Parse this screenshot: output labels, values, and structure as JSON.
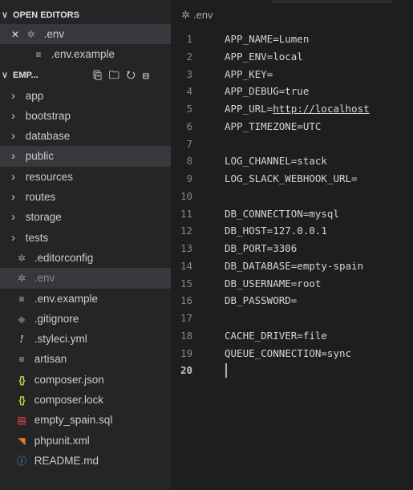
{
  "sidebar": {
    "open_editors": {
      "header": "OPEN EDITORS",
      "items": [
        {
          "label": ".env",
          "icon": "gear-icon"
        },
        {
          "label": ".env.example",
          "icon": "lines-icon"
        }
      ]
    },
    "explorer": {
      "header": "EMP...",
      "toolbar_icons": [
        "new-file-icon",
        "new-folder-icon",
        "refresh-icon",
        "collapse-all-icon"
      ],
      "folders": [
        {
          "label": "app"
        },
        {
          "label": "bootstrap"
        },
        {
          "label": "database"
        },
        {
          "label": "public"
        },
        {
          "label": "resources"
        },
        {
          "label": "routes"
        },
        {
          "label": "storage"
        },
        {
          "label": "tests"
        }
      ],
      "files": [
        {
          "label": ".editorconfig",
          "icon": "gear-icon"
        },
        {
          "label": ".env",
          "icon": "gear-icon"
        },
        {
          "label": ".env.example",
          "icon": "lines-icon"
        },
        {
          "label": ".gitignore",
          "icon": "diamond-icon"
        },
        {
          "label": ".styleci.yml",
          "icon": "exclamation-icon"
        },
        {
          "label": "artisan",
          "icon": "lines-icon"
        },
        {
          "label": "composer.json",
          "icon": "braces-icon"
        },
        {
          "label": "composer.lock",
          "icon": "braces-icon"
        },
        {
          "label": "empty_spain.sql",
          "icon": "database-icon"
        },
        {
          "label": "phpunit.xml",
          "icon": "rss-icon"
        },
        {
          "label": "README.md",
          "icon": "info-icon"
        }
      ]
    }
  },
  "editor": {
    "breadcrumb": ".env",
    "lines": [
      {
        "num": "1",
        "text": "APP_NAME=Lumen"
      },
      {
        "num": "2",
        "text": "APP_ENV=local"
      },
      {
        "num": "3",
        "text": "APP_KEY="
      },
      {
        "num": "4",
        "text": "APP_DEBUG=true"
      },
      {
        "num": "5",
        "text": "APP_URL=",
        "link": "http://localhost"
      },
      {
        "num": "6",
        "text": "APP_TIMEZONE=UTC"
      },
      {
        "num": "7",
        "text": ""
      },
      {
        "num": "8",
        "text": "LOG_CHANNEL=stack"
      },
      {
        "num": "9",
        "text": "LOG_SLACK_WEBHOOK_URL="
      },
      {
        "num": "10",
        "text": ""
      },
      {
        "num": "11",
        "text": "DB_CONNECTION=mysql"
      },
      {
        "num": "12",
        "text": "DB_HOST=127.0.0.1"
      },
      {
        "num": "13",
        "text": "DB_PORT=3306"
      },
      {
        "num": "14",
        "text": "DB_DATABASE=empty-spain"
      },
      {
        "num": "15",
        "text": "DB_USERNAME=root"
      },
      {
        "num": "16",
        "text": "DB_PASSWORD="
      },
      {
        "num": "17",
        "text": ""
      },
      {
        "num": "18",
        "text": "CACHE_DRIVER=file"
      },
      {
        "num": "19",
        "text": "QUEUE_CONNECTION=sync"
      },
      {
        "num": "20",
        "text": ""
      }
    ],
    "current_line": "20"
  }
}
